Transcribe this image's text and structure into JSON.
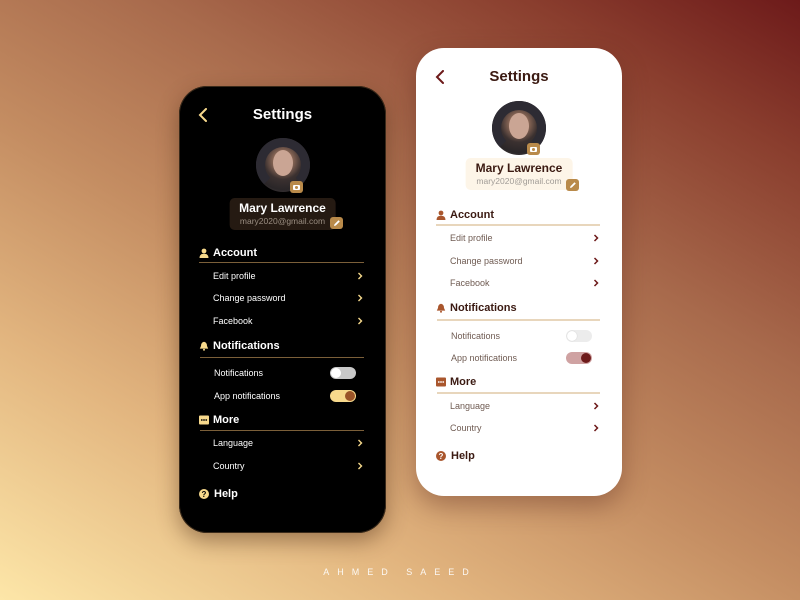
{
  "designer_credit": "AHMED SAEED",
  "colors": {
    "dark_accent": "#f7d98c",
    "dark_toggle_on_track": "#f7d98c",
    "dark_toggle_on_knob": "#9a5428",
    "light_accent": "#6d1a1a",
    "light_icon": "#a9562d",
    "light_toggle_on_track": "#cfa2a2",
    "light_toggle_on_knob": "#6d1a1a",
    "badge": "#b98a4a"
  },
  "screens": [
    {
      "theme": "dark",
      "header": {
        "title": "Settings",
        "back_icon": "chevron-left-icon"
      },
      "profile": {
        "name": "Mary Lawrence",
        "email": "mary2020@gmail.com",
        "camera_icon": "camera-icon",
        "edit_icon": "pencil-icon"
      },
      "sections": {
        "account": {
          "title": "Account",
          "icon": "user-icon",
          "items": [
            {
              "label": "Edit profile"
            },
            {
              "label": "Change password"
            },
            {
              "label": "Facebook"
            }
          ]
        },
        "notifications": {
          "title": "Notifications",
          "icon": "bell-icon",
          "items": [
            {
              "label": "Notifications",
              "enabled": false
            },
            {
              "label": "App notifications",
              "enabled": true
            }
          ]
        },
        "more": {
          "title": "More",
          "icon": "more-icon",
          "items": [
            {
              "label": "Language"
            },
            {
              "label": "Country"
            }
          ]
        }
      },
      "help": {
        "label": "Help",
        "icon": "question-icon"
      }
    },
    {
      "theme": "light",
      "header": {
        "title": "Settings",
        "back_icon": "chevron-left-icon"
      },
      "profile": {
        "name": "Mary Lawrence",
        "email": "mary2020@gmail.com",
        "camera_icon": "camera-icon",
        "edit_icon": "pencil-icon"
      },
      "sections": {
        "account": {
          "title": "Account",
          "icon": "user-icon",
          "items": [
            {
              "label": "Edit profile"
            },
            {
              "label": "Change password"
            },
            {
              "label": "Facebook"
            }
          ]
        },
        "notifications": {
          "title": "Notifications",
          "icon": "bell-icon",
          "items": [
            {
              "label": "Notifications",
              "enabled": false
            },
            {
              "label": "App notifications",
              "enabled": true
            }
          ]
        },
        "more": {
          "title": "More",
          "icon": "more-icon",
          "items": [
            {
              "label": "Language"
            },
            {
              "label": "Country"
            }
          ]
        }
      },
      "help": {
        "label": "Help",
        "icon": "question-icon"
      }
    }
  ]
}
